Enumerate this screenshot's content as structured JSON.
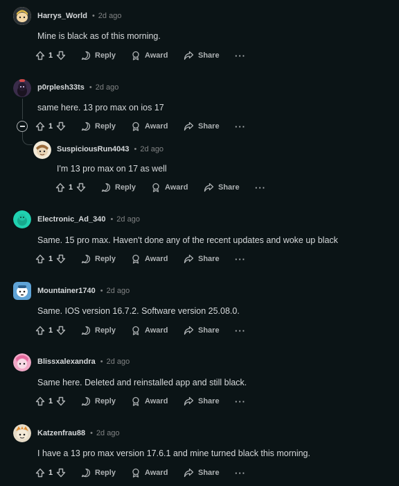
{
  "labels": {
    "reply": "Reply",
    "award": "Award",
    "share": "Share",
    "more": "···"
  },
  "comments": [
    {
      "username": "Harrys_World",
      "time": "2d ago",
      "text": "Mine is black as of this morning.",
      "votes": "1"
    },
    {
      "username": "p0rplesh33ts",
      "time": "2d ago",
      "text": "same here. 13 pro max on ios 17",
      "votes": "1"
    },
    {
      "username": "SuspiciousRun4043",
      "time": "2d ago",
      "text": "I'm 13 pro max on 17 as well",
      "votes": "1"
    },
    {
      "username": "Electronic_Ad_340",
      "time": "2d ago",
      "text": "Same. 15 pro max. Haven't done any of the recent updates and woke up black",
      "votes": "1"
    },
    {
      "username": "Mountainer1740",
      "time": "2d ago",
      "text": "Same. IOS version 16.7.2. Software version 25.08.0.",
      "votes": "1"
    },
    {
      "username": "Blissxalexandra",
      "time": "2d ago",
      "text": "Same here. Deleted and reinstalled app and still black.",
      "votes": "1"
    },
    {
      "username": "Katzenfrau88",
      "time": "2d ago",
      "text": "I have a 13 pro max version 17.6.1 and mine turned black this morning.",
      "votes": "1"
    }
  ]
}
